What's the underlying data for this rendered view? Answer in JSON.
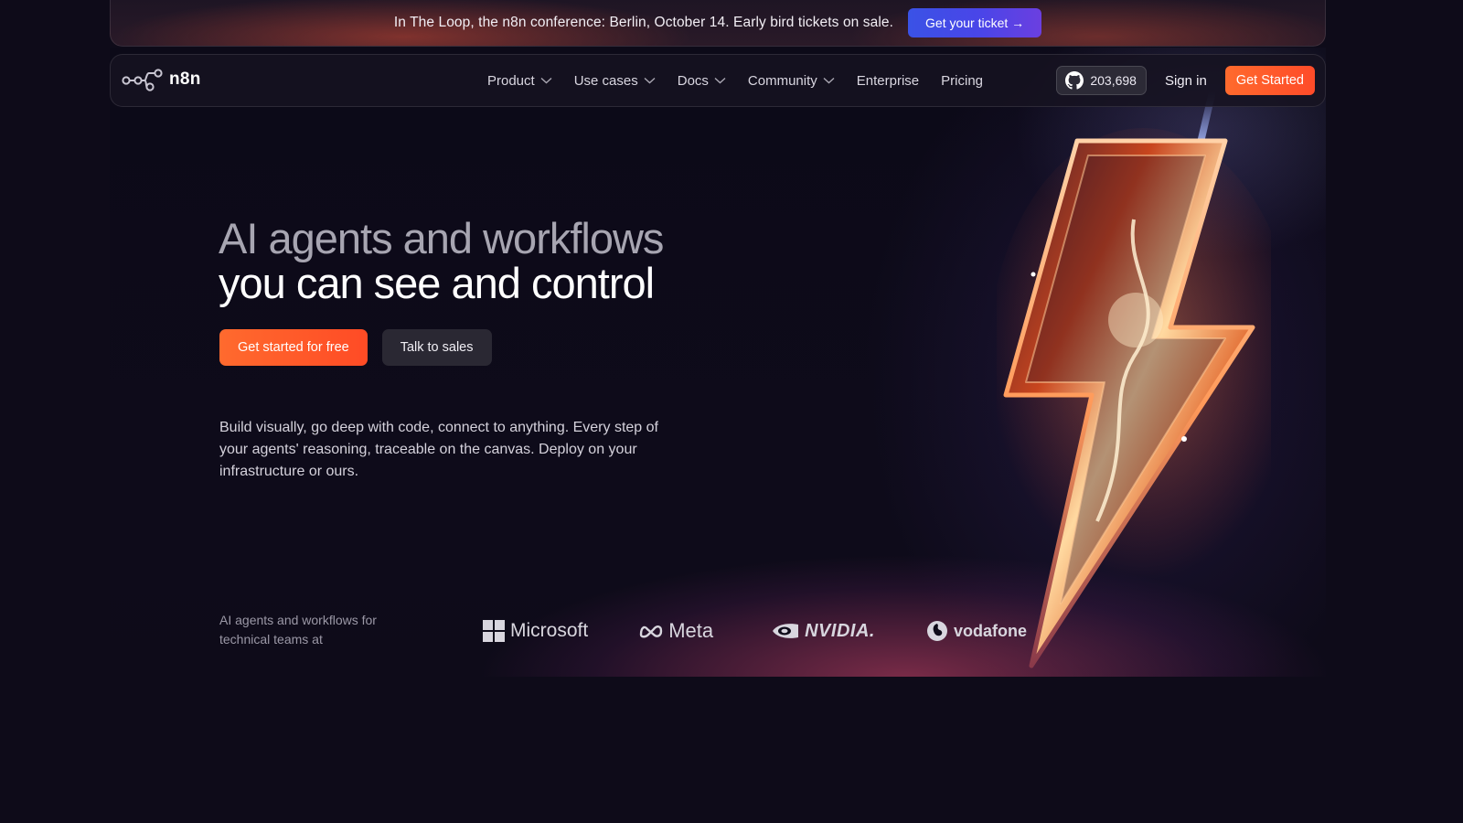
{
  "banner": {
    "text": "In The Loop, the n8n conference: Berlin, October 14. Early bird tickets on sale.",
    "button_label": "Get your ticket →"
  },
  "nav": {
    "logo_text": "n8n",
    "items": [
      {
        "label": "Product",
        "has_dropdown": true
      },
      {
        "label": "Use cases",
        "has_dropdown": true
      },
      {
        "label": "Docs",
        "has_dropdown": true
      },
      {
        "label": "Community",
        "has_dropdown": true
      },
      {
        "label": "Enterprise",
        "has_dropdown": false
      },
      {
        "label": "Pricing",
        "has_dropdown": false
      }
    ],
    "github_stars": "203,698",
    "github_icon": "github-icon",
    "signin_label": "Sign in",
    "cta_label": "Get Started"
  },
  "hero": {
    "headline_line1": "AI agents and workflows",
    "headline_line2": "you can see and control",
    "primary_button": "Get started for free",
    "secondary_button": "Talk to sales",
    "subtext": "Build visually, go deep with code, connect to anything. Every step of your agents' reasoning, traceable on the canvas. Deploy on your infrastructure or ours.",
    "illustration": "lightning-bolt"
  },
  "logos": {
    "label": "AI agents and workflows for technical teams at",
    "brands": [
      "Microsoft",
      "Meta",
      "NVIDIA.",
      "vodafone"
    ]
  },
  "colors": {
    "background": "#0e0b19",
    "accent_orange": "#ff5a2a",
    "banner_button": "#4a45e8",
    "headline_muted": "#a7a5b1"
  }
}
